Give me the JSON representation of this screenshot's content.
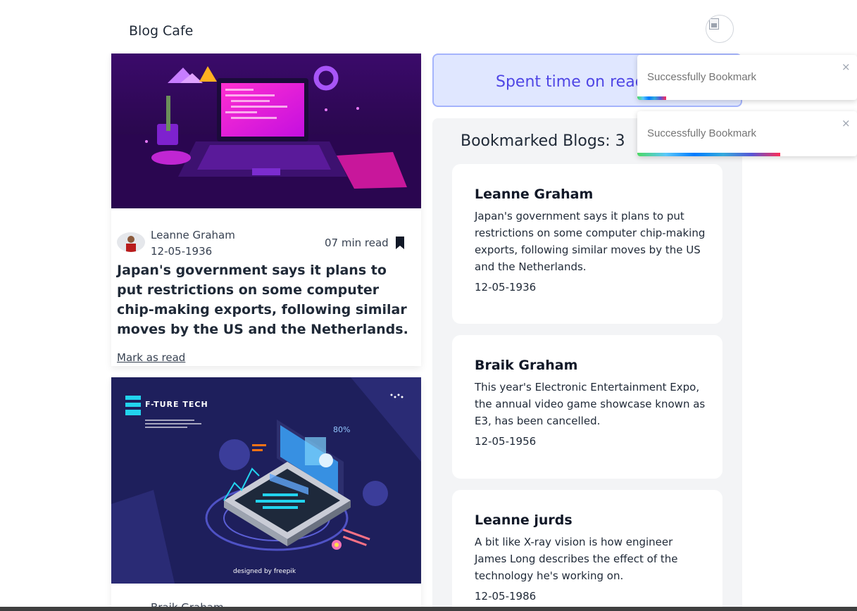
{
  "header": {
    "brand": "Blog Cafe"
  },
  "blogs": [
    {
      "author": "Leanne Graham",
      "date": "12-05-1936",
      "read_time": "07 min read",
      "title": "Japan's government says it plans to put restrictions on some computer chip-making exports, following similar moves by the US and the Netherlands.",
      "mark_read": "Mark as read"
    },
    {
      "author": "Braik Graham",
      "cover_text": {
        "brand": "F-TURE TECH",
        "credit": "designed by freepik",
        "percent": "80%"
      }
    }
  ],
  "sidebar": {
    "spent_time": "Spent time on read",
    "bookmarked_heading": "Bookmarked Blogs: 3",
    "bookmarks": [
      {
        "author": "Leanne Graham",
        "text": "Japan's government says it plans to put restrictions on some computer chip-making exports, following similar moves by the US and the Netherlands.",
        "date": "12-05-1936"
      },
      {
        "author": "Braik Graham",
        "text": "This year's Electronic Entertainment Expo, the annual video game showcase known as E3, has been cancelled.",
        "date": "12-05-1956"
      },
      {
        "author": "Leanne jurds",
        "text": "A bit like X-ray vision is how engineer James Long describes the effect of the technology he's working on.",
        "date": "12-05-1986"
      }
    ]
  },
  "toasts": [
    {
      "message": "Successfully Bookmark",
      "close": "×",
      "progress": 0.13
    },
    {
      "message": "Successfully Bookmark",
      "close": "×",
      "progress": 0.65
    }
  ],
  "colors": {
    "accent": "#4f46e5",
    "spent_bg": "#e0e7ff",
    "panel_bg": "#f3f4f6"
  }
}
